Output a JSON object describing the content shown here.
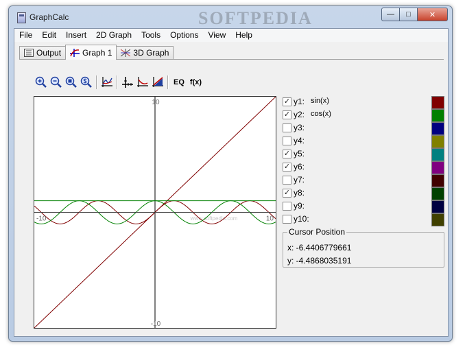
{
  "window": {
    "title": "GraphCalc",
    "watermark": "SOFTPEDIA",
    "controls": {
      "minimize": "—",
      "maximize": "□",
      "close": "✕"
    }
  },
  "menu": [
    "File",
    "Edit",
    "Insert",
    "2D Graph",
    "Tools",
    "Options",
    "View",
    "Help"
  ],
  "tabs": [
    {
      "label": "Output",
      "icon": "output-list-icon",
      "active": false
    },
    {
      "label": "Graph 1",
      "icon": "graph-2d-icon",
      "active": true
    },
    {
      "label": "3D Graph",
      "icon": "graph-3d-icon",
      "active": false
    }
  ],
  "toolbar": {
    "buttons": [
      "zoom-in-icon",
      "zoom-out-icon",
      "zoom-box-icon",
      "zoom-standard-icon",
      "graph-trace-icon",
      "axes-icon",
      "axes-curve-icon",
      "area-icon"
    ],
    "eq_label": "EQ",
    "fx_label": "f(x)"
  },
  "graph": {
    "y_max_label": "10",
    "y_min_label": "-10",
    "x_min_label": "-10",
    "x_max_label": "10",
    "axis_watermark": "www.softpedia.com"
  },
  "chart_data": {
    "type": "line",
    "xlim": [
      -10,
      10
    ],
    "ylim": [
      -10,
      10
    ],
    "tick_labels": {
      "y_top": "10",
      "y_bottom": "-10",
      "x_left": "-10",
      "x_right": "10"
    },
    "series": [
      {
        "name": "sin(x)",
        "function": "sin",
        "color": "#800000"
      },
      {
        "name": "cos(x)",
        "function": "cos",
        "color": "#008000"
      },
      {
        "function": "identity",
        "color": "#800000"
      },
      {
        "function": "constant",
        "value": 1,
        "color": "#008000"
      },
      {
        "function": "constant",
        "value": 0,
        "color": "#404040"
      }
    ]
  },
  "equations": [
    {
      "label": "y1:",
      "expr": "sin(x)",
      "checked": true,
      "color": "#800000"
    },
    {
      "label": "y2:",
      "expr": "cos(x)",
      "checked": true,
      "color": "#008000"
    },
    {
      "label": "y3:",
      "expr": "",
      "checked": false,
      "color": "#000080"
    },
    {
      "label": "y4:",
      "expr": "",
      "checked": false,
      "color": "#808000"
    },
    {
      "label": "y5:",
      "expr": "",
      "checked": true,
      "color": "#008080"
    },
    {
      "label": "y6:",
      "expr": "",
      "checked": true,
      "color": "#800080"
    },
    {
      "label": "y7:",
      "expr": "",
      "checked": false,
      "color": "#400000"
    },
    {
      "label": "y8:",
      "expr": "",
      "checked": true,
      "color": "#004000"
    },
    {
      "label": "y9:",
      "expr": "",
      "checked": false,
      "color": "#000040"
    },
    {
      "label": "y10:",
      "expr": "",
      "checked": false,
      "color": "#404000"
    }
  ],
  "cursor": {
    "title": "Cursor Position",
    "x": "x: -6.4406779661",
    "y": "y: -4.4868035191"
  }
}
